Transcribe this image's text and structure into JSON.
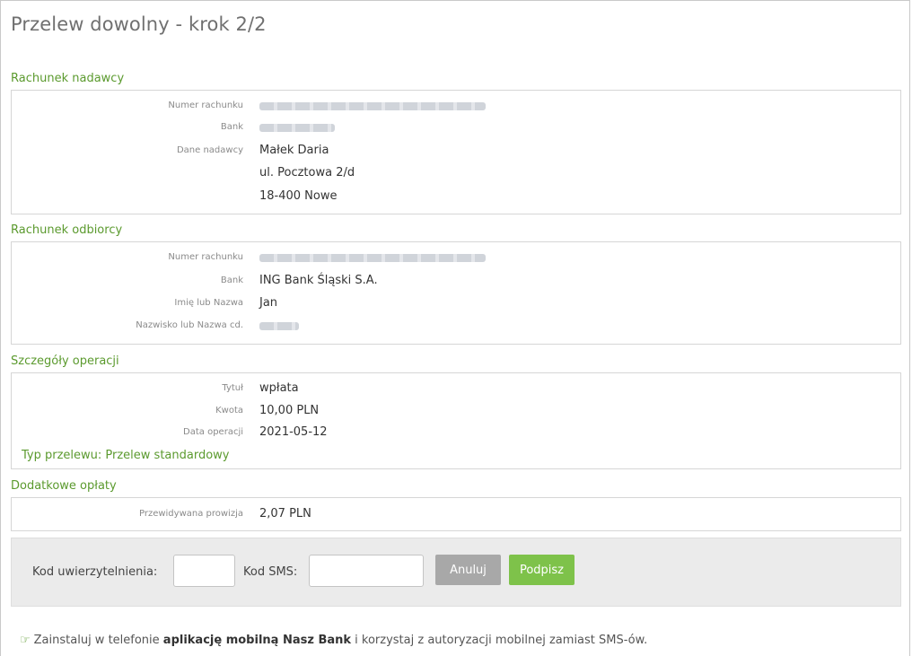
{
  "page": {
    "title": "Przelew dowolny - krok 2/2"
  },
  "sender": {
    "section_title": "Rachunek nadawcy",
    "account_label": "Numer rachunku",
    "bank_label": "Bank",
    "data_label": "Dane nadawcy",
    "name": "Małek Daria",
    "street": "ul. Pocztowa 2/d",
    "city": "18-400 Nowe"
  },
  "recipient": {
    "section_title": "Rachunek odbiorcy",
    "account_label": "Numer rachunku",
    "bank_label": "Bank",
    "bank": "ING Bank Śląski S.A.",
    "first_name_label": "Imię lub Nazwa",
    "first_name": "Jan",
    "last_name_label": "Nazwisko lub Nazwa cd."
  },
  "details": {
    "section_title": "Szczegóły operacji",
    "title_label": "Tytuł",
    "title": "wpłata",
    "amount_label": "Kwota",
    "amount": "10,00 PLN",
    "date_label": "Data operacji",
    "date": "2021-05-12",
    "transfer_type": "Typ przelewu: Przelew standardowy"
  },
  "fees": {
    "section_title": "Dodatkowe opłaty",
    "commission_label": "Przewidywana prowizja",
    "commission": "2,07 PLN"
  },
  "auth": {
    "auth_code_label": "Kod uwierzytelnienia:",
    "auth_code_value": "",
    "sms_code_label": "Kod SMS:",
    "sms_code_value": "",
    "cancel_label": "Anuluj",
    "sign_label": "Podpisz"
  },
  "promo": {
    "icon": "hand-pointing-icon",
    "text_before": "Zainstaluj w telefonie ",
    "text_bold": "aplikację mobilną Nasz Bank",
    "text_after": " i korzystaj z autoryzacji mobilnej zamiast SMS-ów."
  },
  "colors": {
    "accent_green": "#5b9a2e",
    "sign_button": "#7ec24a",
    "cancel_button": "#a8a8a8",
    "auth_bar_bg": "#ebebeb"
  }
}
